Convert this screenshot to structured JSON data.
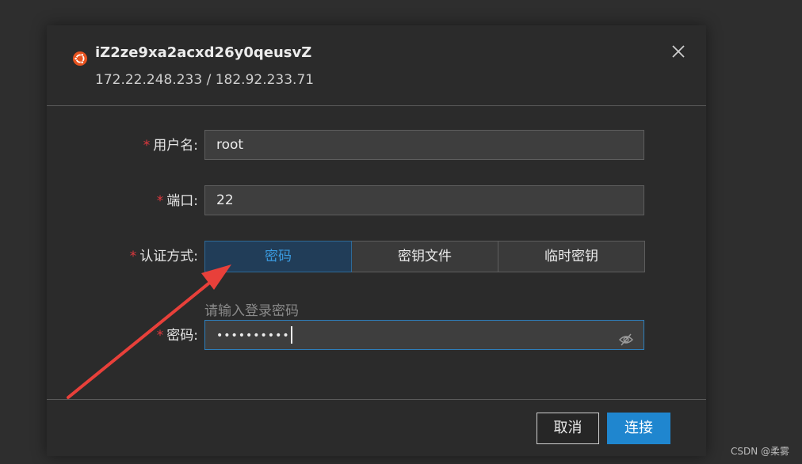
{
  "header": {
    "host_name": "iZ2ze9xa2acxd26y0qeusvZ",
    "host_ip": "172.22.248.233 / 182.92.233.71",
    "os_icon": "ubuntu-icon",
    "close_icon": "close-icon"
  },
  "form": {
    "required_mark": "*",
    "username": {
      "label": "用户名:",
      "value": "root"
    },
    "port": {
      "label": "端口:",
      "value": "22"
    },
    "auth": {
      "label": "认证方式:",
      "options": [
        "密码",
        "密钥文件",
        "临时密钥"
      ],
      "selected": "密码",
      "hint": "请输入登录密码"
    },
    "password": {
      "label": "密码:",
      "masked_value": "••••••••••",
      "toggle_icon": "eye-slash-icon"
    }
  },
  "footer": {
    "cancel_label": "取消",
    "connect_label": "连接"
  },
  "watermark": "CSDN @柔雾",
  "colors": {
    "accent": "#1f86cf",
    "required": "#e0383e",
    "annotation_arrow": "#e8403a"
  }
}
